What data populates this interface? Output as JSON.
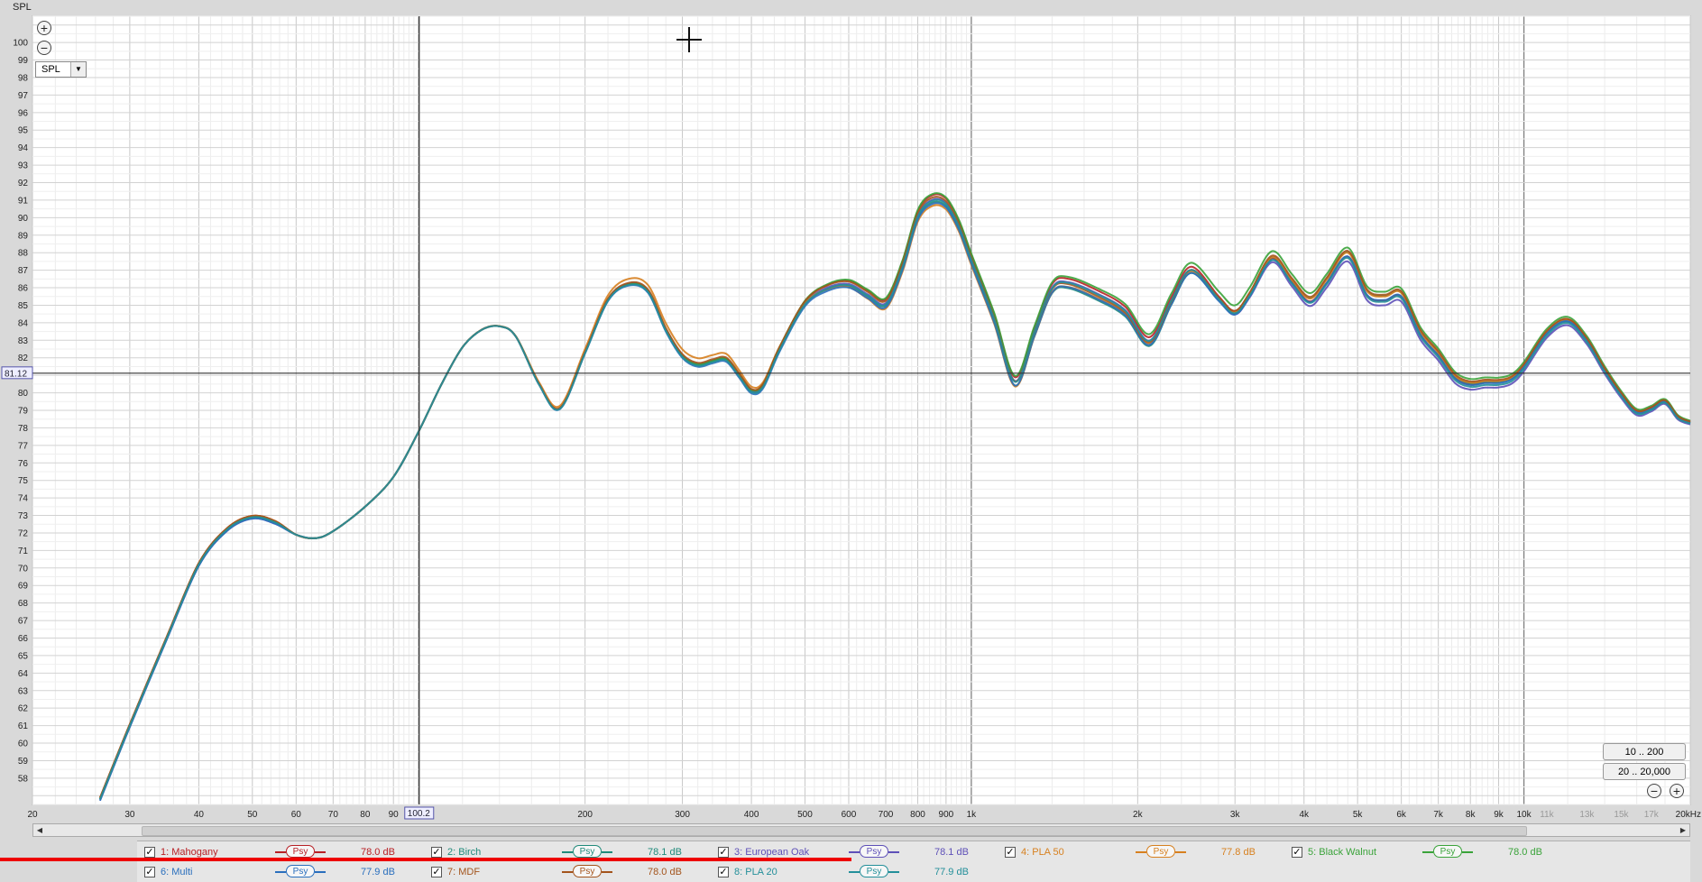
{
  "app": {
    "title": "SPL"
  },
  "controls": {
    "zoom_in_icon": "plus-circle-icon",
    "zoom_out_icon": "minus-circle-icon",
    "measure_select": "SPL",
    "range_button_1": "10 .. 200",
    "range_button_2": "20 .. 20,000",
    "cursor_freq_label": "100.2",
    "cursor_level_label": "81.12"
  },
  "chart_data": {
    "type": "line",
    "title": "",
    "xlabel": "",
    "ylabel": "",
    "xscale": "log",
    "xlim": [
      20,
      20000
    ],
    "ylim": [
      56.5,
      101.5
    ],
    "grid": true,
    "legend": "bottom",
    "cursor": {
      "x": 100.2,
      "y": 81.12
    },
    "y_ticks": [
      58,
      59,
      60,
      61,
      62,
      63,
      64,
      65,
      66,
      67,
      68,
      69,
      70,
      71,
      72,
      73,
      74,
      75,
      76,
      77,
      78,
      79,
      80,
      81,
      82,
      83,
      84,
      85,
      86,
      87,
      88,
      89,
      90,
      91,
      92,
      93,
      94,
      95,
      96,
      97,
      98,
      99,
      100
    ],
    "x_ticks": [
      {
        "v": 20,
        "label": "20",
        "bold": true
      },
      {
        "v": 30,
        "label": "30",
        "bold": true
      },
      {
        "v": 40,
        "label": "40",
        "bold": true
      },
      {
        "v": 50,
        "label": "50",
        "bold": true
      },
      {
        "v": 60,
        "label": "60",
        "bold": true
      },
      {
        "v": 70,
        "label": "70",
        "bold": true
      },
      {
        "v": 80,
        "label": "80",
        "bold": true
      },
      {
        "v": 90,
        "label": "90",
        "bold": true
      },
      {
        "v": 200,
        "label": "200",
        "bold": true
      },
      {
        "v": 300,
        "label": "300",
        "bold": true
      },
      {
        "v": 400,
        "label": "400",
        "bold": true
      },
      {
        "v": 500,
        "label": "500",
        "bold": true
      },
      {
        "v": 600,
        "label": "600",
        "bold": true
      },
      {
        "v": 700,
        "label": "700",
        "bold": true
      },
      {
        "v": 800,
        "label": "800",
        "bold": true
      },
      {
        "v": 900,
        "label": "900",
        "bold": true
      },
      {
        "v": 1000,
        "label": "1k",
        "bold": true
      },
      {
        "v": 2000,
        "label": "2k",
        "bold": true
      },
      {
        "v": 3000,
        "label": "3k",
        "bold": true
      },
      {
        "v": 4000,
        "label": "4k",
        "bold": true
      },
      {
        "v": 5000,
        "label": "5k",
        "bold": true
      },
      {
        "v": 6000,
        "label": "6k",
        "bold": true
      },
      {
        "v": 7000,
        "label": "7k",
        "bold": true
      },
      {
        "v": 8000,
        "label": "8k",
        "bold": true
      },
      {
        "v": 9000,
        "label": "9k",
        "bold": true
      },
      {
        "v": 10000,
        "label": "10k",
        "bold": true
      },
      {
        "v": 11000,
        "label": "11k",
        "bold": false
      },
      {
        "v": 13000,
        "label": "13k",
        "bold": false
      },
      {
        "v": 15000,
        "label": "15k",
        "bold": false
      },
      {
        "v": 17000,
        "label": "17k",
        "bold": false
      },
      {
        "v": 20000,
        "label": "20kHz",
        "bold": true
      }
    ],
    "base_curve": {
      "x": [
        26.5,
        30,
        35,
        40,
        45,
        50,
        55,
        60,
        65,
        70,
        80,
        90,
        100,
        110,
        120,
        130,
        140,
        150,
        165,
        180,
        200,
        220,
        240,
        260,
        280,
        300,
        320,
        340,
        360,
        380,
        400,
        420,
        450,
        500,
        550,
        600,
        650,
        700,
        750,
        800,
        850,
        900,
        950,
        1000,
        1100,
        1200,
        1300,
        1400,
        1500,
        1700,
        1900,
        2100,
        2300,
        2500,
        2800,
        3000,
        3200,
        3500,
        3800,
        4100,
        4400,
        4800,
        5200,
        5600,
        6000,
        6500,
        7000,
        7500,
        8000,
        8500,
        9000,
        9500,
        10000,
        11000,
        12000,
        13000,
        14000,
        15000,
        16000,
        17000,
        18000,
        19000,
        20000
      ],
      "y": [
        56.8,
        61,
        66,
        70.2,
        72.2,
        72.9,
        72.6,
        71.9,
        71.7,
        72.1,
        73.5,
        75.2,
        77.8,
        80.5,
        82.6,
        83.6,
        83.8,
        83.2,
        80.5,
        79.1,
        82.3,
        85.3,
        86.2,
        85.8,
        83.6,
        82.1,
        81.6,
        81.8,
        81.9,
        81.0,
        80.1,
        80.4,
        82.5,
        85.1,
        86.0,
        86.2,
        85.6,
        85.1,
        87.2,
        90.1,
        91.0,
        90.8,
        89.5,
        87.6,
        84.2,
        80.6,
        83.4,
        85.9,
        86.2,
        85.5,
        84.6,
        82.9,
        85.2,
        87.0,
        85.4,
        84.6,
        85.7,
        87.7,
        86.4,
        85.3,
        86.4,
        87.9,
        85.7,
        85.4,
        85.6,
        83.4,
        82.2,
        80.9,
        80.5,
        80.6,
        80.6,
        80.8,
        81.5,
        83.4,
        84.1,
        83.0,
        81.3,
        79.9,
        78.9,
        79.1,
        79.5,
        78.6,
        78.3
      ]
    },
    "series": [
      {
        "name": "1: Mahogany",
        "color": "#b82025",
        "offsets": [
          0.0,
          0.25,
          0.3,
          -0.15,
          0.1
        ]
      },
      {
        "name": "2: Birch",
        "color": "#1f8a7a",
        "offsets": [
          0.0,
          -0.1,
          -0.25,
          0.15,
          -0.05
        ]
      },
      {
        "name": "3: European Oak",
        "color": "#5e50b8",
        "offsets": [
          0.05,
          0.0,
          0.15,
          -0.4,
          -0.2
        ]
      },
      {
        "name": "4: PLA 50",
        "color": "#d7801f",
        "offsets": [
          0.4,
          -0.35,
          -0.1,
          0.1,
          0.05
        ]
      },
      {
        "name": "5: Black Walnut",
        "color": "#3aa33a",
        "offsets": [
          0.0,
          0.3,
          0.4,
          0.35,
          0.2
        ]
      },
      {
        "name": "6: Multi",
        "color": "#2a6fbd",
        "offsets": [
          -0.1,
          -0.2,
          -0.15,
          -0.1,
          0.0
        ]
      },
      {
        "name": "7: MDF",
        "color": "#a3541c",
        "offsets": [
          0.1,
          0.15,
          -0.05,
          0.2,
          0.1
        ]
      },
      {
        "name": "8: PLA 20",
        "color": "#238f9a",
        "offsets": [
          -0.05,
          -0.05,
          0.1,
          -0.2,
          -0.1
        ]
      }
    ]
  },
  "legend": [
    {
      "name": "1: Mahogany",
      "psy": "Psy",
      "db": "78.0 dB",
      "color": "#b82025",
      "checked": "✓"
    },
    {
      "name": "2: Birch",
      "psy": "Psy",
      "db": "78.1 dB",
      "color": "#1f8a7a",
      "checked": "✓"
    },
    {
      "name": "3: European Oak",
      "psy": "Psy",
      "db": "78.1 dB",
      "color": "#5e50b8",
      "checked": "✓"
    },
    {
      "name": "4: PLA 50",
      "psy": "Psy",
      "db": "77.8 dB",
      "color": "#d7801f",
      "checked": "✓"
    },
    {
      "name": "5: Black Walnut",
      "psy": "Psy",
      "db": "78.0 dB",
      "color": "#3aa33a",
      "checked": "✓"
    },
    {
      "name": "6: Multi",
      "psy": "Psy",
      "db": "77.9 dB",
      "color": "#2a6fbd",
      "checked": "✓"
    },
    {
      "name": "7: MDF",
      "psy": "Psy",
      "db": "78.0 dB",
      "color": "#a3541c",
      "checked": "✓"
    },
    {
      "name": "8: PLA 20",
      "psy": "Psy",
      "db": "77.9 dB",
      "color": "#238f9a",
      "checked": "✓"
    }
  ],
  "video_progress": 0.5
}
